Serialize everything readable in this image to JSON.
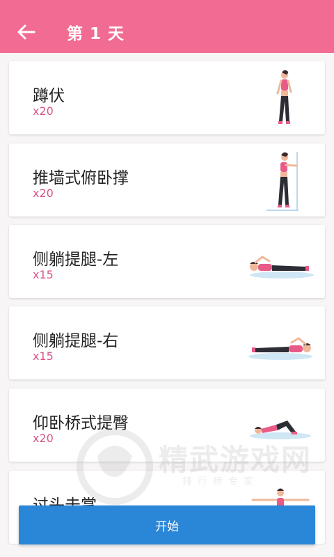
{
  "header": {
    "title": "第 1 天"
  },
  "exercises": [
    {
      "name": "蹲伏",
      "count": "x20"
    },
    {
      "name": "推墙式俯卧撑",
      "count": "x20"
    },
    {
      "name": "侧躺提腿-左",
      "count": "x15"
    },
    {
      "name": "侧躺提腿-右",
      "count": "x15"
    },
    {
      "name": "仰卧桥式提臀",
      "count": "x20"
    },
    {
      "name": "过头击掌",
      "count": ""
    }
  ],
  "watermark": {
    "text": "精武游戏网",
    "subtext": "排行榜专家"
  },
  "footer": {
    "start_label": "开始"
  },
  "colors": {
    "accent": "#f26b92",
    "button": "#2a86d6",
    "count": "#d9558a"
  }
}
